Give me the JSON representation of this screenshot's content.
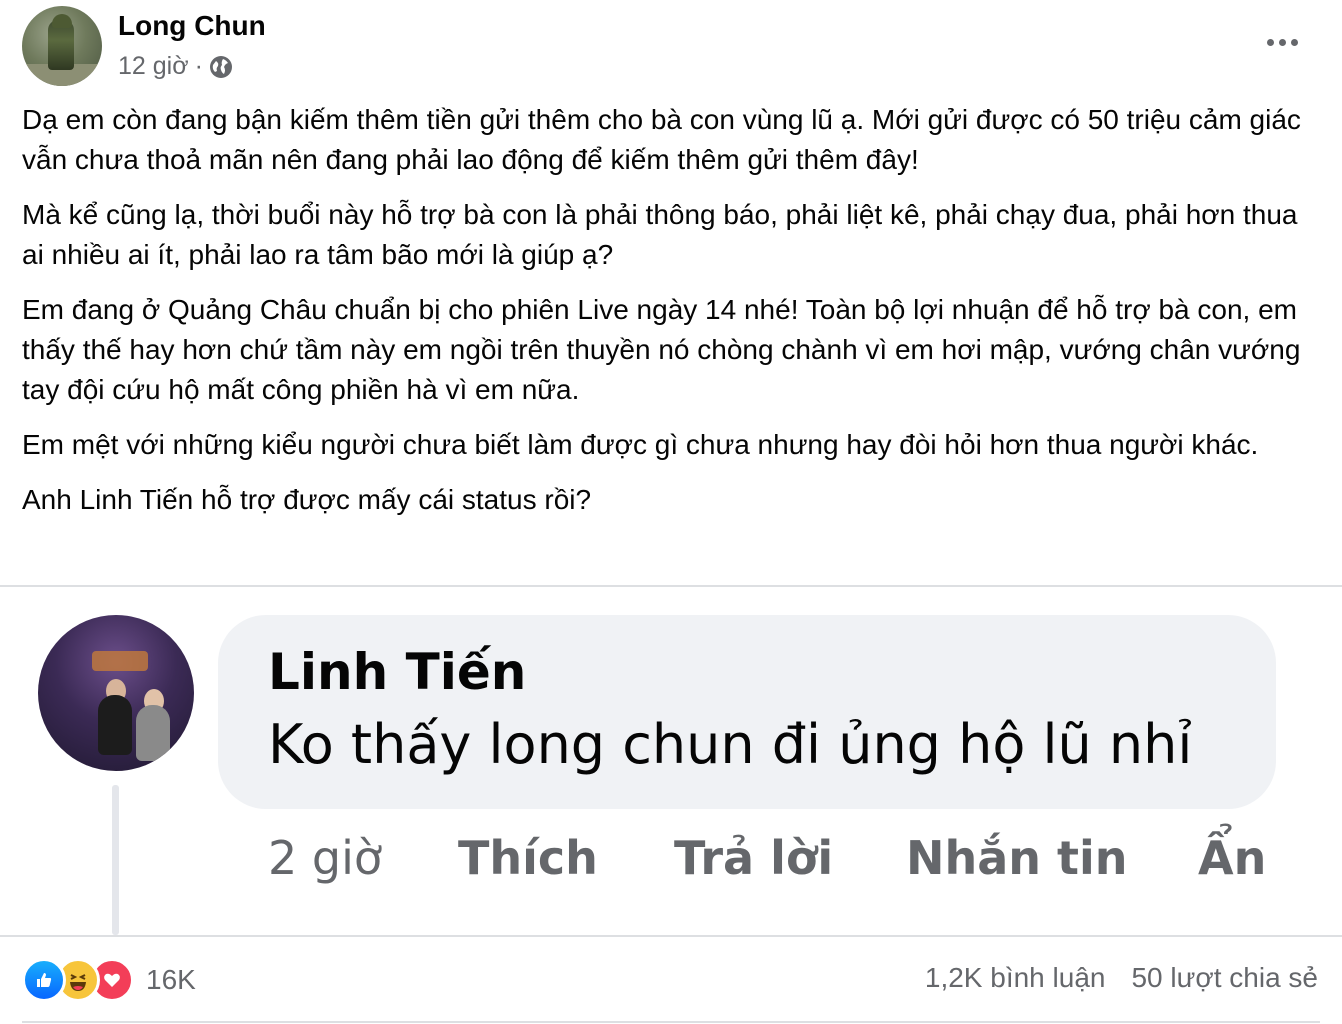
{
  "post": {
    "author": "Long Chun",
    "time": "12 giờ",
    "separator": "·",
    "privacy_icon": "globe-icon",
    "more_icon": "more-horizontal-icon",
    "paragraphs": [
      "Dạ em còn đang bận kiếm thêm tiền gửi thêm cho bà con vùng lũ ạ. Mới gửi được có 50 triệu cảm giác vẫn chưa thoả mãn nên đang phải lao động để kiếm thêm gửi thêm đây!",
      "Mà kể cũng lạ, thời buổi này hỗ trợ bà con là phải thông báo, phải liệt kê, phải chạy đua, phải hơn thua ai nhiều ai ít, phải lao ra tâm bão mới là giúp ạ?",
      "Em đang ở Quảng Châu chuẩn bị cho phiên Live ngày 14 nhé! Toàn bộ lợi nhuận để hỗ trợ bà con, em thấy thế hay hơn chứ tầm này em ngồi trên thuyền nó chòng chành vì em hơi mập, vướng chân vướng tay đội cứu hộ mất công phiền hà vì em nữa.",
      "Em mệt với những kiểu người chưa biết làm được gì chưa nhưng hay đòi hỏi hơn thua người khác.",
      "Anh Linh Tiến hỗ trợ được mấy cái status rồi?"
    ]
  },
  "comment": {
    "name": "Linh Tiến",
    "text": "Ko thấy long chun đi ủng hộ lũ nhỉ",
    "time": "2 giờ",
    "actions": {
      "like": "Thích",
      "reply": "Trả lời",
      "message": "Nhắn tin",
      "hide": "Ẩn"
    }
  },
  "stats": {
    "reaction_icons": [
      "like-icon",
      "haha-icon",
      "love-icon"
    ],
    "reactions": "16K",
    "comments": "1,2K bình luận",
    "shares": "50 lượt chia sẻ"
  },
  "colors": {
    "text_primary": "#050505",
    "text_secondary": "#65676b",
    "bubble": "#f0f2f5",
    "like_blue": "#0866ff",
    "love_red": "#f33e58",
    "haha_yellow": "#f7c53b"
  }
}
